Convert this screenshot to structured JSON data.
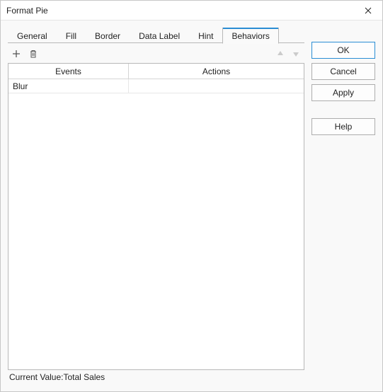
{
  "window": {
    "title": "Format Pie"
  },
  "tabs": [
    {
      "label": "General"
    },
    {
      "label": "Fill"
    },
    {
      "label": "Border"
    },
    {
      "label": "Data Label"
    },
    {
      "label": "Hint"
    },
    {
      "label": "Behaviors",
      "active": true
    }
  ],
  "table": {
    "headers": {
      "events": "Events",
      "actions": "Actions"
    },
    "rows": [
      {
        "event": "Blur",
        "action": ""
      }
    ]
  },
  "status": {
    "label": "Current Value:",
    "value": "Total Sales"
  },
  "buttons": {
    "ok": "OK",
    "cancel": "Cancel",
    "apply": "Apply",
    "help": "Help"
  }
}
